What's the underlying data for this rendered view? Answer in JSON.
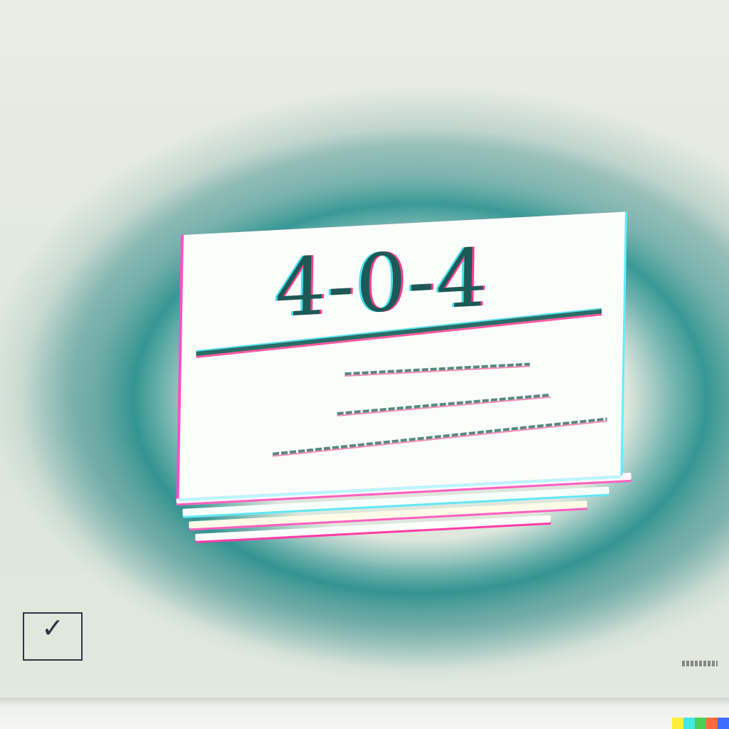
{
  "image": {
    "headline": "4-0-4",
    "subtitle_scribble": "",
    "stamp_glyph": "✓",
    "stamp_text": "",
    "colors": {
      "background": "#e6ebe2",
      "teal_shadow": "#1b8b89",
      "card": "#fbfdfa",
      "magenta_fringe": "#ff4fc8",
      "cyan_fringe": "#5ff0ff",
      "ink": "#1b5a56"
    },
    "swatch_colors": [
      "#ffef3b",
      "#42e8e2",
      "#4ccf56",
      "#ff6b3c",
      "#3c6bff"
    ]
  }
}
